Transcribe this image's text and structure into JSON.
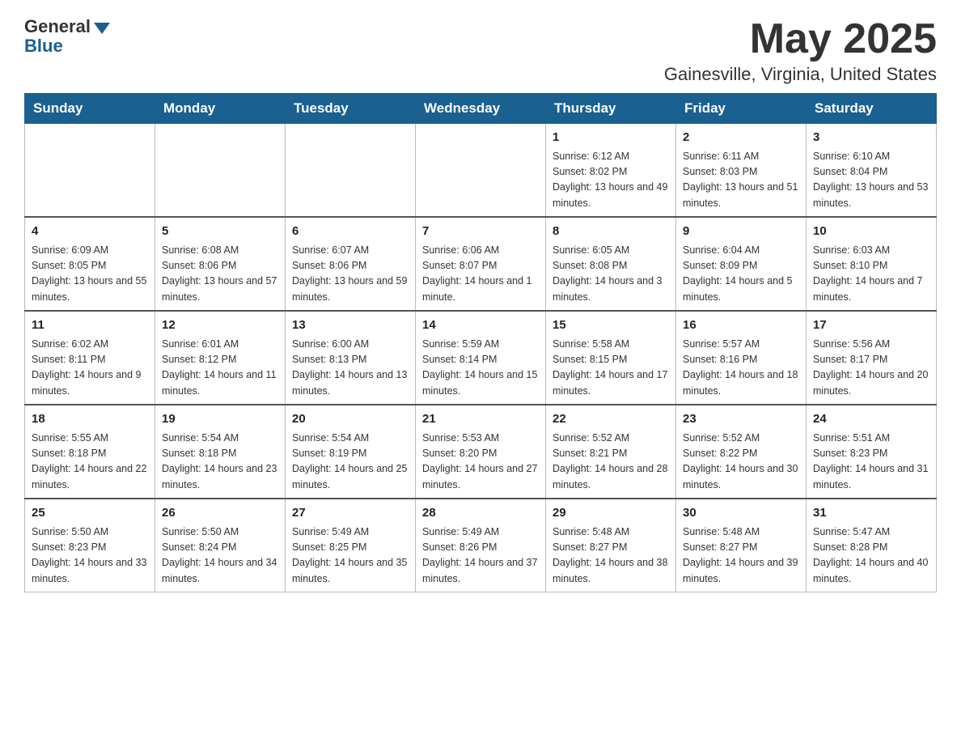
{
  "header": {
    "logo_general": "General",
    "logo_blue": "Blue",
    "month_year": "May 2025",
    "location": "Gainesville, Virginia, United States"
  },
  "days_of_week": [
    "Sunday",
    "Monday",
    "Tuesday",
    "Wednesday",
    "Thursday",
    "Friday",
    "Saturday"
  ],
  "weeks": [
    [
      {
        "day": "",
        "info": ""
      },
      {
        "day": "",
        "info": ""
      },
      {
        "day": "",
        "info": ""
      },
      {
        "day": "",
        "info": ""
      },
      {
        "day": "1",
        "info": "Sunrise: 6:12 AM\nSunset: 8:02 PM\nDaylight: 13 hours and 49 minutes."
      },
      {
        "day": "2",
        "info": "Sunrise: 6:11 AM\nSunset: 8:03 PM\nDaylight: 13 hours and 51 minutes."
      },
      {
        "day": "3",
        "info": "Sunrise: 6:10 AM\nSunset: 8:04 PM\nDaylight: 13 hours and 53 minutes."
      }
    ],
    [
      {
        "day": "4",
        "info": "Sunrise: 6:09 AM\nSunset: 8:05 PM\nDaylight: 13 hours and 55 minutes."
      },
      {
        "day": "5",
        "info": "Sunrise: 6:08 AM\nSunset: 8:06 PM\nDaylight: 13 hours and 57 minutes."
      },
      {
        "day": "6",
        "info": "Sunrise: 6:07 AM\nSunset: 8:06 PM\nDaylight: 13 hours and 59 minutes."
      },
      {
        "day": "7",
        "info": "Sunrise: 6:06 AM\nSunset: 8:07 PM\nDaylight: 14 hours and 1 minute."
      },
      {
        "day": "8",
        "info": "Sunrise: 6:05 AM\nSunset: 8:08 PM\nDaylight: 14 hours and 3 minutes."
      },
      {
        "day": "9",
        "info": "Sunrise: 6:04 AM\nSunset: 8:09 PM\nDaylight: 14 hours and 5 minutes."
      },
      {
        "day": "10",
        "info": "Sunrise: 6:03 AM\nSunset: 8:10 PM\nDaylight: 14 hours and 7 minutes."
      }
    ],
    [
      {
        "day": "11",
        "info": "Sunrise: 6:02 AM\nSunset: 8:11 PM\nDaylight: 14 hours and 9 minutes."
      },
      {
        "day": "12",
        "info": "Sunrise: 6:01 AM\nSunset: 8:12 PM\nDaylight: 14 hours and 11 minutes."
      },
      {
        "day": "13",
        "info": "Sunrise: 6:00 AM\nSunset: 8:13 PM\nDaylight: 14 hours and 13 minutes."
      },
      {
        "day": "14",
        "info": "Sunrise: 5:59 AM\nSunset: 8:14 PM\nDaylight: 14 hours and 15 minutes."
      },
      {
        "day": "15",
        "info": "Sunrise: 5:58 AM\nSunset: 8:15 PM\nDaylight: 14 hours and 17 minutes."
      },
      {
        "day": "16",
        "info": "Sunrise: 5:57 AM\nSunset: 8:16 PM\nDaylight: 14 hours and 18 minutes."
      },
      {
        "day": "17",
        "info": "Sunrise: 5:56 AM\nSunset: 8:17 PM\nDaylight: 14 hours and 20 minutes."
      }
    ],
    [
      {
        "day": "18",
        "info": "Sunrise: 5:55 AM\nSunset: 8:18 PM\nDaylight: 14 hours and 22 minutes."
      },
      {
        "day": "19",
        "info": "Sunrise: 5:54 AM\nSunset: 8:18 PM\nDaylight: 14 hours and 23 minutes."
      },
      {
        "day": "20",
        "info": "Sunrise: 5:54 AM\nSunset: 8:19 PM\nDaylight: 14 hours and 25 minutes."
      },
      {
        "day": "21",
        "info": "Sunrise: 5:53 AM\nSunset: 8:20 PM\nDaylight: 14 hours and 27 minutes."
      },
      {
        "day": "22",
        "info": "Sunrise: 5:52 AM\nSunset: 8:21 PM\nDaylight: 14 hours and 28 minutes."
      },
      {
        "day": "23",
        "info": "Sunrise: 5:52 AM\nSunset: 8:22 PM\nDaylight: 14 hours and 30 minutes."
      },
      {
        "day": "24",
        "info": "Sunrise: 5:51 AM\nSunset: 8:23 PM\nDaylight: 14 hours and 31 minutes."
      }
    ],
    [
      {
        "day": "25",
        "info": "Sunrise: 5:50 AM\nSunset: 8:23 PM\nDaylight: 14 hours and 33 minutes."
      },
      {
        "day": "26",
        "info": "Sunrise: 5:50 AM\nSunset: 8:24 PM\nDaylight: 14 hours and 34 minutes."
      },
      {
        "day": "27",
        "info": "Sunrise: 5:49 AM\nSunset: 8:25 PM\nDaylight: 14 hours and 35 minutes."
      },
      {
        "day": "28",
        "info": "Sunrise: 5:49 AM\nSunset: 8:26 PM\nDaylight: 14 hours and 37 minutes."
      },
      {
        "day": "29",
        "info": "Sunrise: 5:48 AM\nSunset: 8:27 PM\nDaylight: 14 hours and 38 minutes."
      },
      {
        "day": "30",
        "info": "Sunrise: 5:48 AM\nSunset: 8:27 PM\nDaylight: 14 hours and 39 minutes."
      },
      {
        "day": "31",
        "info": "Sunrise: 5:47 AM\nSunset: 8:28 PM\nDaylight: 14 hours and 40 minutes."
      }
    ]
  ]
}
